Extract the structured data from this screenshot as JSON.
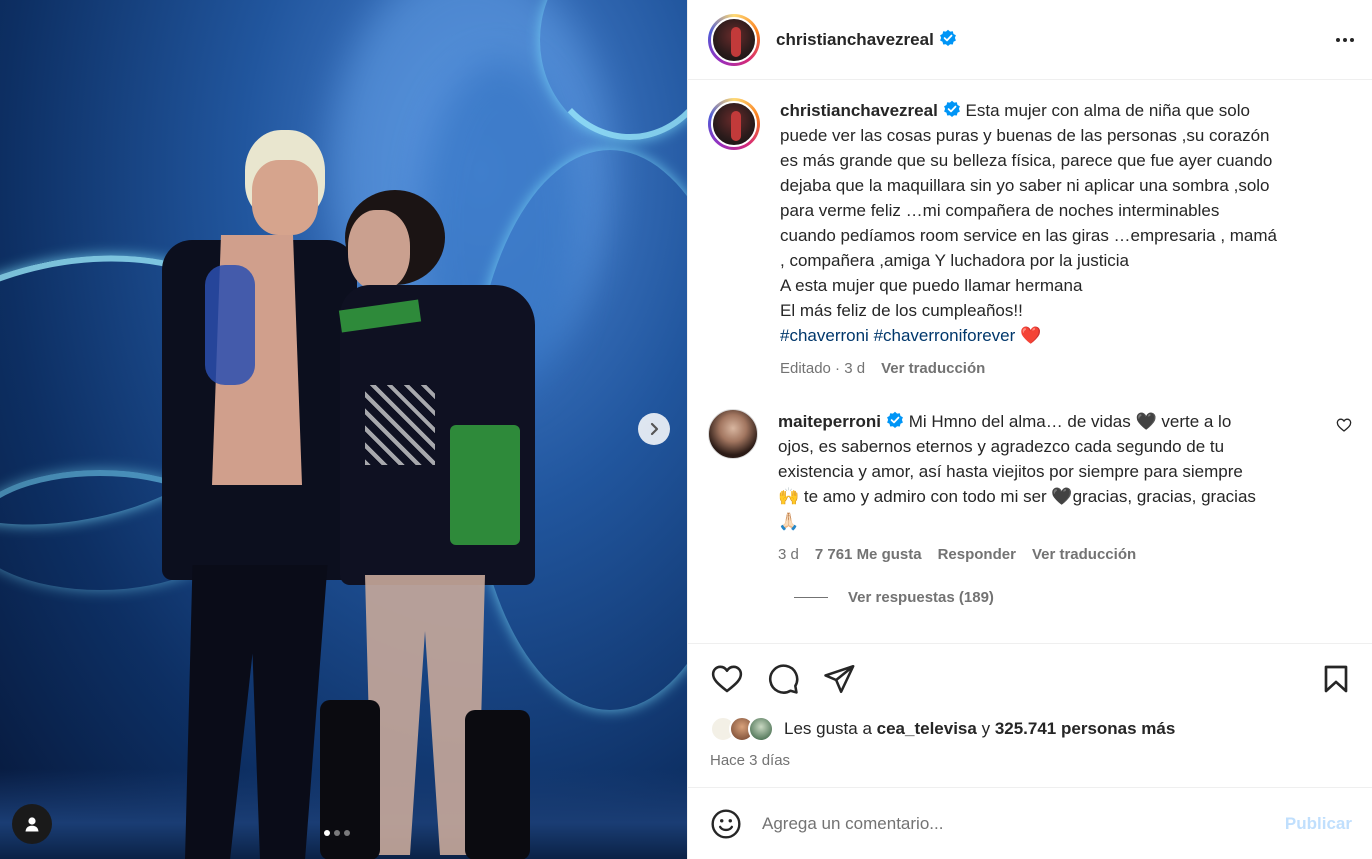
{
  "post": {
    "author": "christianchavezreal",
    "caption_lines": [
      "Esta mujer con alma de niña que solo",
      "puede ver las cosas puras y buenas de las personas ,su corazón",
      "es más grande que su belleza física, parece que fue ayer cuando",
      "dejaba que la maquillara sin yo saber ni aplicar una sombra ,solo",
      "para verme feliz …mi compañera de noches interminables",
      "cuando pedíamos room service en las giras …empresaria , mamá",
      ", compañera ,amiga Y luchadora por la justicia",
      "A esta mujer que puedo llamar hermana",
      "El más feliz de los cumpleaños!!"
    ],
    "hashtags": [
      "#chaverroni",
      "#chaverroniforever"
    ],
    "caption_emoji": "❤️",
    "edited_label": "Editado",
    "age": "3 d",
    "translate_label": "Ver traducción"
  },
  "comment": {
    "author": "maiteperroni",
    "lines": [
      "Mi Hmno del alma… de vidas 🖤 verte a lo",
      "ojos, es sabernos eternos y agradezco cada segundo de tu",
      "existencia y amor, así hasta viejitos por siempre para siempre",
      "🙌 te amo y admiro con todo mi ser 🖤gracias, gracias, gracias",
      "🙏🏻"
    ],
    "age": "3 d",
    "likes": "7 761 Me gusta",
    "reply_label": "Responder",
    "translate_label": "Ver traducción",
    "view_replies": "Ver respuestas (189)"
  },
  "likes_bar": {
    "prefix": "Les gusta a",
    "liker": "cea_televisa",
    "connector": "y",
    "others": "325.741 personas más",
    "time_ago": "Hace 3 días"
  },
  "composer": {
    "placeholder": "Agrega un comentario...",
    "post_label": "Publicar"
  },
  "carousel": {
    "slides": 3,
    "active": 0
  },
  "colors": {
    "verified": "#0095f6",
    "hashtag": "#00376b",
    "muted": "#737373",
    "post_disabled": "#c0dffd"
  }
}
